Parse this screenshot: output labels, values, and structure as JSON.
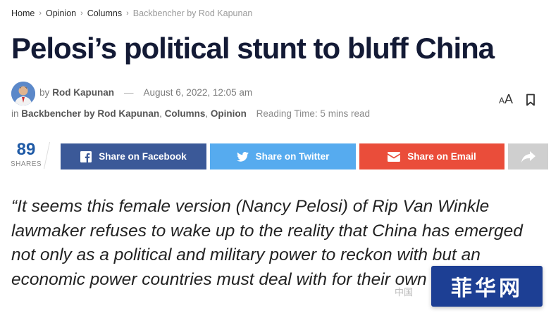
{
  "breadcrumb": {
    "items": [
      "Home",
      "Opinion",
      "Columns"
    ],
    "current": "Backbencher by Rod Kapunan",
    "separator": "›"
  },
  "article": {
    "title": "Pelosi’s political stunt to bluff China",
    "by_prefix": "by",
    "author": "Rod Kapunan",
    "dash": "—",
    "date": "August 6, 2022, 12:05 am",
    "in_prefix": "in",
    "categories": [
      "Backbencher by Rod Kapunan",
      "Columns",
      "Opinion"
    ],
    "reading_time": "Reading Time: 5 mins read",
    "quote": "“It seems this female version (Nancy Pelosi) of Rip Van Winkle lawmaker refuses to wake up to the reality that China has emerged not only as a political and military power to reckon with but an economic power countries must deal with for their own economic"
  },
  "tools": {
    "font_small": "A",
    "font_big": "A"
  },
  "shares": {
    "count": "89",
    "label": "SHARES"
  },
  "share_buttons": {
    "facebook": "Share on Facebook",
    "twitter": "Share on Twitter",
    "email": "Share on Email"
  },
  "watermark": {
    "text": "菲华网",
    "under": "中国"
  },
  "colors": {
    "facebook": "#3b5998",
    "twitter": "#56abef",
    "email": "#ea4d3a",
    "more": "#cfcfcf",
    "share_count": "#1f5aa6",
    "title": "#131a35",
    "watermark_bg": "#1d3f94"
  },
  "icons": [
    "chevron-right-icon",
    "bookmark-icon",
    "facebook-icon",
    "twitter-icon",
    "email-icon",
    "share-arrow-icon",
    "avatar"
  ]
}
